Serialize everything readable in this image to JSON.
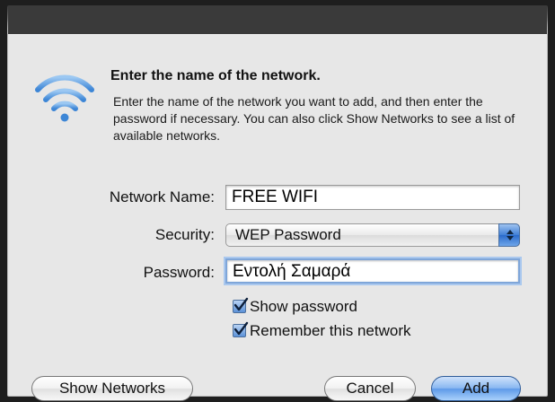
{
  "dialog": {
    "heading": "Enter the name of the network.",
    "description": "Enter the name of the network you want to add, and then enter the password if necessary. You can also click Show Networks to see a list of available networks."
  },
  "form": {
    "network_name": {
      "label": "Network Name:",
      "value": "FREE WIFI"
    },
    "security": {
      "label": "Security:",
      "value": "WEP Password"
    },
    "password": {
      "label": "Password:",
      "value": "Εντολή Σαμαρά"
    }
  },
  "checkboxes": {
    "show_password": {
      "label": "Show password",
      "checked": true
    },
    "remember_network": {
      "label": "Remember this network",
      "checked": true
    }
  },
  "buttons": {
    "show_networks": "Show Networks",
    "cancel": "Cancel",
    "add": "Add"
  },
  "icons": {
    "wifi": "wifi-icon",
    "select_arrows": "up-down-arrows-icon",
    "checkmark": "checkmark-icon"
  },
  "colors": {
    "accent": "#4a90e2",
    "dialog_bg": "#e7e7e7"
  }
}
